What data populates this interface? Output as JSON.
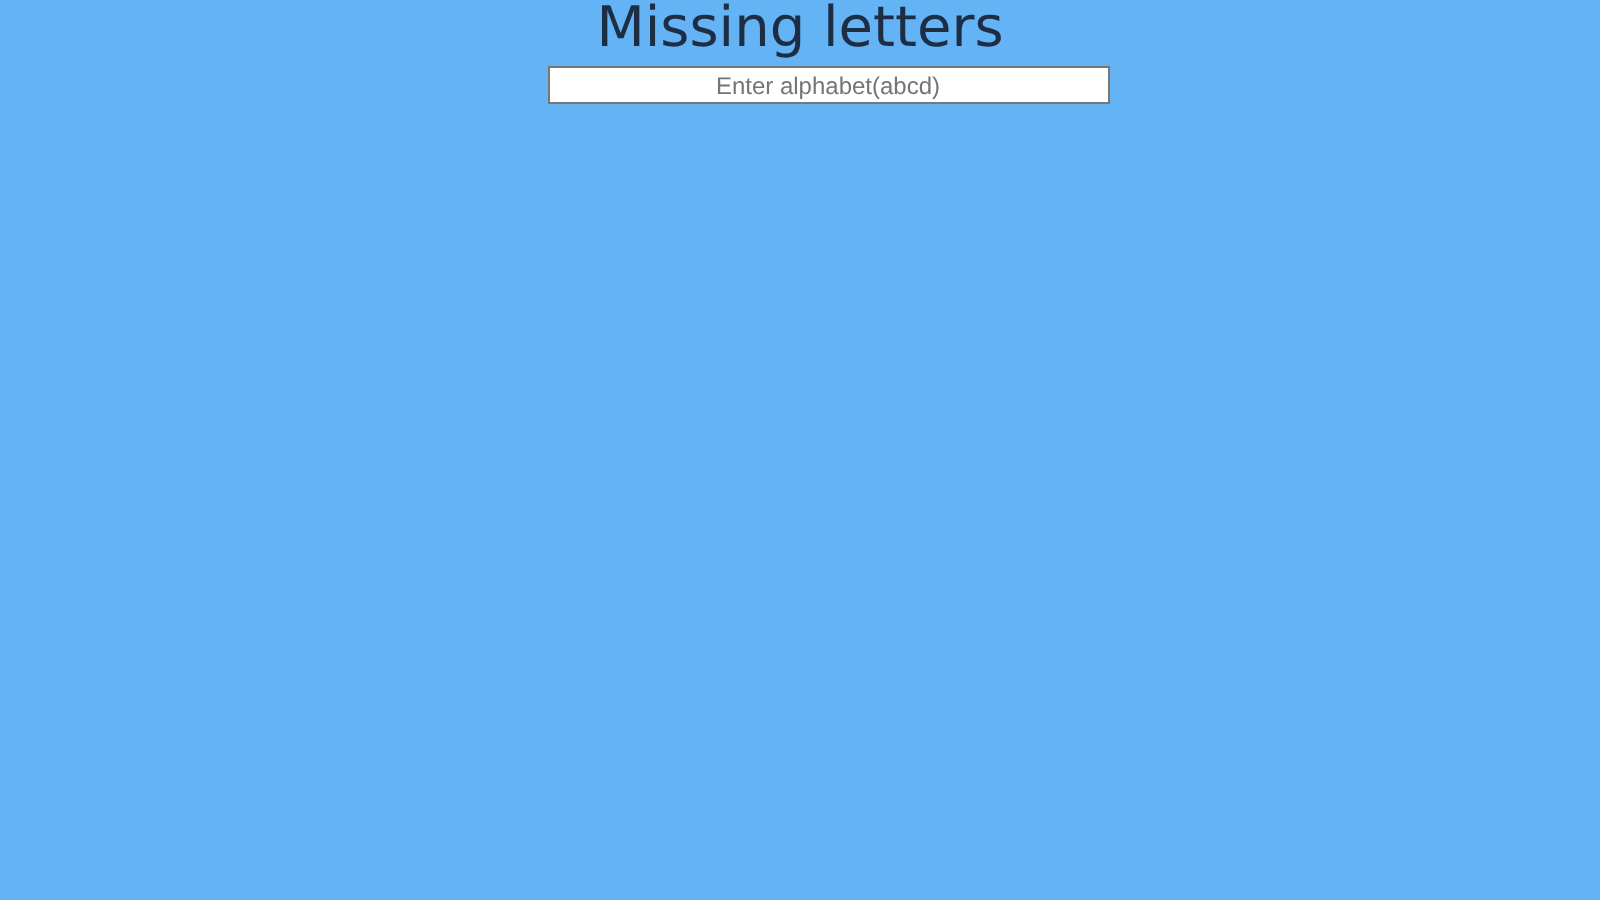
{
  "title": "Missing letters",
  "input": {
    "placeholder": "Enter alphabet(abcd)"
  }
}
